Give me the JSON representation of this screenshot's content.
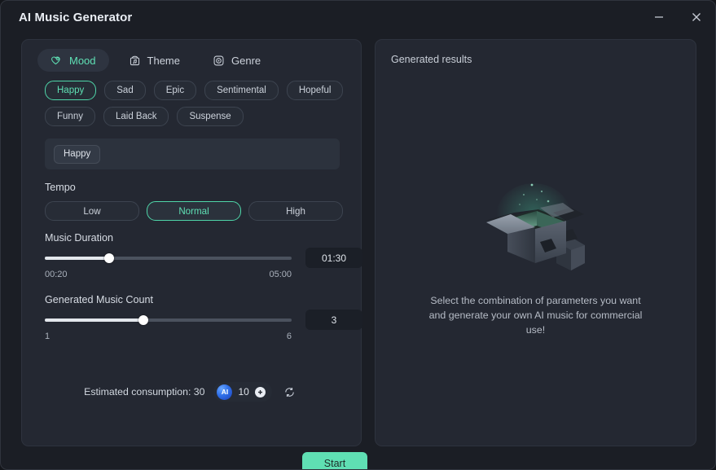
{
  "window": {
    "title": "AI Music Generator",
    "minimize_label": "Minimize",
    "close_label": "Close"
  },
  "tabs": [
    {
      "label": "Mood",
      "icon": "heart-icon",
      "active": true
    },
    {
      "label": "Theme",
      "icon": "music-box-icon",
      "active": false
    },
    {
      "label": "Genre",
      "icon": "disc-icon",
      "active": false
    }
  ],
  "moods": [
    {
      "label": "Happy",
      "selected": true
    },
    {
      "label": "Sad",
      "selected": false
    },
    {
      "label": "Epic",
      "selected": false
    },
    {
      "label": "Sentimental",
      "selected": false
    },
    {
      "label": "Hopeful",
      "selected": false
    },
    {
      "label": "Funny",
      "selected": false
    },
    {
      "label": "Laid Back",
      "selected": false
    },
    {
      "label": "Suspense",
      "selected": false
    }
  ],
  "selected_tags": [
    "Happy"
  ],
  "tempo": {
    "label": "Tempo",
    "options": [
      {
        "label": "Low",
        "selected": false
      },
      {
        "label": "Normal",
        "selected": true
      },
      {
        "label": "High",
        "selected": false
      }
    ]
  },
  "duration": {
    "label": "Music Duration",
    "value": "01:30",
    "min_label": "00:20",
    "max_label": "05:00",
    "percent": 26
  },
  "count": {
    "label": "Generated Music Count",
    "value": "3",
    "min_label": "1",
    "max_label": "6",
    "percent": 40
  },
  "consumption": {
    "text": "Estimated consumption: 30",
    "credits": "10",
    "badge_text": "AI",
    "add_icon": "plus-icon",
    "refresh_icon": "refresh-icon"
  },
  "start_button": {
    "label": "Start"
  },
  "results": {
    "title": "Generated results",
    "empty_text": "Select the combination of parameters you want and generate your own AI music for commercial use!",
    "illustration": "open-box-icon"
  },
  "colors": {
    "accent": "#5fe0b4",
    "start_bg": "#5fdfb3",
    "panel_bg": "#242832",
    "window_bg": "#1b1e25"
  }
}
